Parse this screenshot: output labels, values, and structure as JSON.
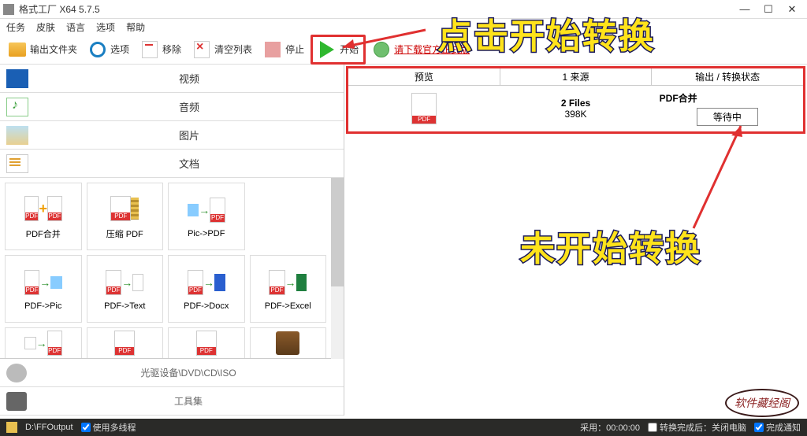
{
  "window": {
    "title": "格式工厂 X64 5.7.5",
    "min": "—",
    "max": "☐",
    "close": "✕"
  },
  "menu": {
    "task": "任务",
    "skin": "皮肤",
    "language": "语言",
    "options": "选项",
    "help": "帮助"
  },
  "toolbar": {
    "output_folder": "输出文件夹",
    "options": "选项",
    "remove": "移除",
    "clear_list": "清空列表",
    "stop": "停止",
    "start": "开始",
    "download_official": "请下载官方正式版"
  },
  "categories": {
    "video": "视频",
    "audio": "音频",
    "image": "图片",
    "document": "文档"
  },
  "tools": {
    "pdf_merge": "PDF合并",
    "compress_pdf": "压缩 PDF",
    "pic_to_pdf": "Pic->PDF",
    "pdf_to_pic": "PDF->Pic",
    "pdf_to_text": "PDF->Text",
    "pdf_to_docx": "PDF->Docx",
    "pdf_to_excel": "PDF->Excel"
  },
  "subcats": {
    "optical": "光驱设备\\DVD\\CD\\ISO",
    "toolset": "工具集"
  },
  "task_list": {
    "col_preview": "预览",
    "col_source": "1 来源",
    "col_output": "输出 / 转换状态",
    "row1": {
      "files": "2 Files",
      "size": "398K",
      "output_name": "PDF合并",
      "status": "等待中"
    }
  },
  "annotations": {
    "click_start": "点击开始转换",
    "not_started": "未开始转换",
    "watermark": "软件藏经阁"
  },
  "statusbar": {
    "path": "D:\\FFOutput",
    "multithread": "使用多线程",
    "elapsed": "采用：00:00:00",
    "shutdown_after": "转换完成后：关闭电脑",
    "notify_complete": "完成通知"
  }
}
